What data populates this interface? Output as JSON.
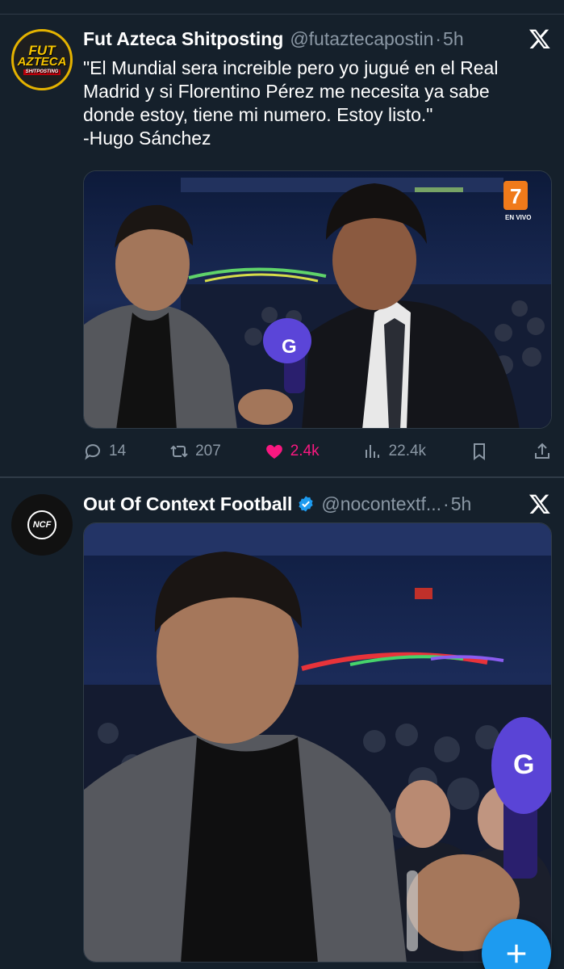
{
  "tweets": [
    {
      "author": "Fut Azteca Shitposting",
      "handle": "@futaztecapostin",
      "separator": "·",
      "time": "5h",
      "avatar_text": [
        "FUT",
        "AZTECA",
        "SHITPOSTING"
      ],
      "text_lines": [
        "\"El Mundial sera increible pero yo jugué en el Real",
        "Madrid y si Florentino Pérez me necesita ya sabe",
        "donde estoy, tiene mi numero. Estoy listo.\"",
        "-Hugo Sánchez"
      ],
      "media": {
        "broadcast_logo": "7",
        "broadcast_label": "EN VIVO"
      },
      "actions": {
        "replies": "14",
        "reposts": "207",
        "likes": "2.4k",
        "views": "22.4k"
      }
    },
    {
      "author": "Out Of Context Football",
      "handle": "@nocontextf...",
      "separator": "·",
      "time": "5h",
      "avatar_text": "NCF",
      "verified": true
    }
  ],
  "colors": {
    "background": "#15202b",
    "accent": "#1d9bf0",
    "like": "#f91880",
    "secondary_text": "#8b98a5"
  },
  "icons": [
    "x-logo-icon",
    "reply-icon",
    "repost-icon",
    "heart-icon",
    "views-icon",
    "bookmark-icon",
    "share-icon",
    "verified-badge-icon",
    "plus-icon"
  ]
}
